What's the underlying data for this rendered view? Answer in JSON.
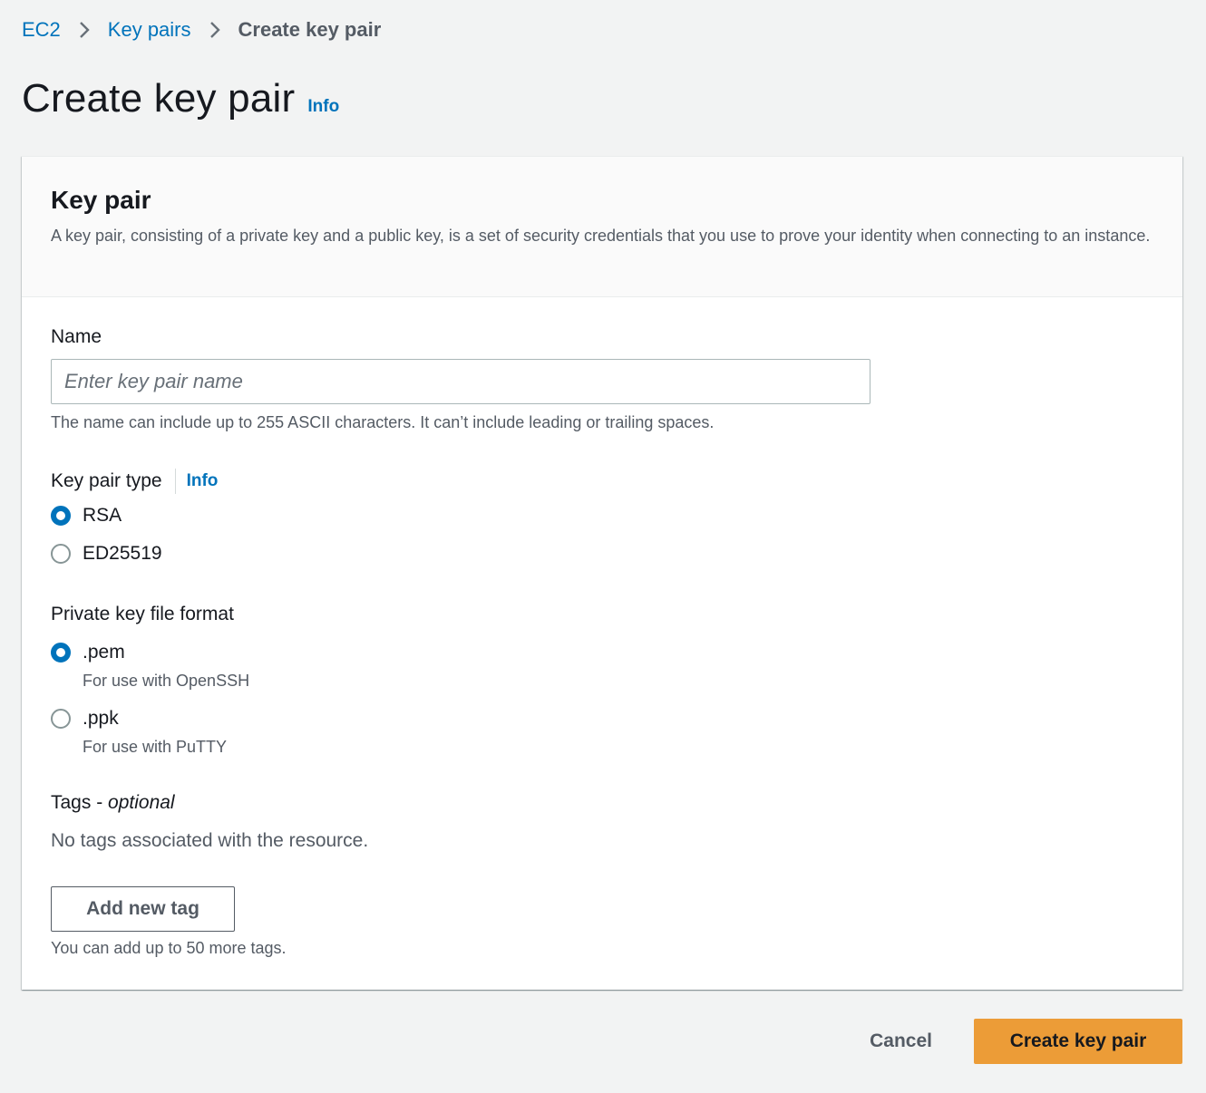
{
  "breadcrumb": {
    "items": [
      "EC2",
      "Key pairs"
    ],
    "current": "Create key pair"
  },
  "page": {
    "title": "Create key pair",
    "info_label": "Info"
  },
  "panel": {
    "title": "Key pair",
    "description": "A key pair, consisting of a private key and a public key, is a set of security credentials that you use to prove your identity when connecting to an instance."
  },
  "name_field": {
    "label": "Name",
    "placeholder": "Enter key pair name",
    "value": "",
    "hint": "The name can include up to 255 ASCII characters. It can’t include leading or trailing spaces."
  },
  "key_pair_type": {
    "label": "Key pair type",
    "info_label": "Info",
    "options": [
      {
        "label": "RSA",
        "checked": true
      },
      {
        "label": "ED25519",
        "checked": false
      }
    ]
  },
  "file_format": {
    "label": "Private key file format",
    "options": [
      {
        "label": ".pem",
        "description": "For use with OpenSSH",
        "checked": true
      },
      {
        "label": ".ppk",
        "description": "For use with PuTTY",
        "checked": false
      }
    ]
  },
  "tags": {
    "label": "Tags",
    "separator": " - ",
    "optional_label": "optional",
    "empty_text": "No tags associated with the resource.",
    "add_button": "Add new tag",
    "hint": "You can add up to 50 more tags."
  },
  "actions": {
    "cancel": "Cancel",
    "create": "Create key pair"
  },
  "colors": {
    "link": "#0073bb",
    "primary_button": "#ec9c37",
    "background": "#f2f3f3"
  }
}
